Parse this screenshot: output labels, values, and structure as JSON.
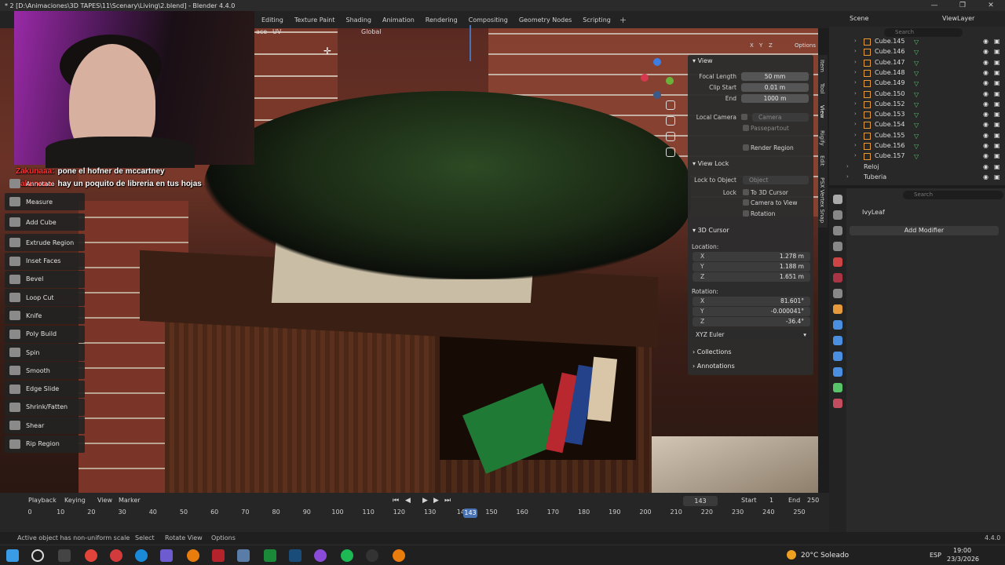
{
  "window": {
    "title": "* 2 [D:\\Animaciones\\3D TAPES\\11\\Scenary\\Living\\2.blend] - Blender 4.4.0",
    "controls": [
      "—",
      "❐",
      "✕"
    ]
  },
  "workspaces": [
    "Editing",
    "Texture Paint",
    "Shading",
    "Animation",
    "Rendering",
    "Compositing",
    "Geometry Nodes",
    "Scripting"
  ],
  "workspace_add": "+",
  "scene": {
    "label": "Scene",
    "view_layer": "ViewLayer"
  },
  "viewport_header": {
    "mode_items": [
      "ace",
      "UV"
    ],
    "orientation": "Global",
    "axes": [
      "X",
      "Y",
      "Z"
    ],
    "options": "Options"
  },
  "chat": [
    {
      "user": "Zakunaaa:",
      "message": "pone el hofner de mccartney"
    },
    {
      "user": "Zakunaaa:",
      "message": "hay un poquito de libreria en tus hojas"
    }
  ],
  "toolbar": {
    "tools": [
      "Annotate",
      "Measure",
      "Add Cube",
      "Extrude Region",
      "Inset Faces",
      "Bevel",
      "Loop Cut",
      "Knife",
      "Poly Build",
      "Spin",
      "Smooth",
      "Edge Slide",
      "Shrink/Fatten",
      "Shear",
      "Rip Region"
    ]
  },
  "npanel": {
    "view": {
      "title": "View",
      "focal_length_label": "Focal Length",
      "focal_length": "50 mm",
      "clip_start_label": "Clip Start",
      "clip_start": "0.01 m",
      "end_label": "End",
      "end": "1000 m",
      "local_camera_label": "Local Camera",
      "local_camera_placeholder": "Camera",
      "passepartout": "Passepartout",
      "render_region": "Render Region"
    },
    "view_lock": {
      "title": "View Lock",
      "lock_to_object_label": "Lock to Object",
      "lock_to_object_placeholder": "Object",
      "lock_label": "Lock",
      "to_3d_cursor": "To 3D Cursor",
      "camera_to_view": "Camera to View",
      "rotation": "Rotation"
    },
    "cursor": {
      "title": "3D Cursor",
      "location_label": "Location:",
      "location": [
        {
          "axis": "X",
          "value": "1.278 m"
        },
        {
          "axis": "Y",
          "value": "1.188 m"
        },
        {
          "axis": "Z",
          "value": "1.651 m"
        }
      ],
      "rotation_label": "Rotation:",
      "rotation": [
        {
          "axis": "X",
          "value": "81.601°"
        },
        {
          "axis": "Y",
          "value": "-0.000041°"
        },
        {
          "axis": "Z",
          "value": "-36.4°"
        }
      ],
      "rotation_mode": "XYZ Euler"
    },
    "collections": "Collections",
    "annotations": "Annotations"
  },
  "side_tabs": [
    "Item",
    "Tool",
    "View",
    "Rigify",
    "Edit",
    "PSX Vertex Snap"
  ],
  "outliner": {
    "search_placeholder": "Search",
    "rows": [
      "Cube.145",
      "Cube.146",
      "Cube.147",
      "Cube.148",
      "Cube.149",
      "Cube.150",
      "Cube.152",
      "Cube.153",
      "Cube.154",
      "Cube.155",
      "Cube.156",
      "Cube.157"
    ],
    "collections": [
      "Reloj",
      "Tuberia"
    ]
  },
  "properties": {
    "search_placeholder": "Search",
    "object_name": "IvyLeaf",
    "add_modifier": "Add Modifier"
  },
  "timeline": {
    "menus": [
      "Playback",
      "Keying",
      "View",
      "Marker"
    ],
    "current_frame": "143",
    "start_label": "Start",
    "start": "1",
    "end_label": "End",
    "end": "250",
    "ticks": [
      "0",
      "10",
      "20",
      "30",
      "40",
      "50",
      "60",
      "70",
      "80",
      "90",
      "100",
      "110",
      "120",
      "130",
      "14",
      "150",
      "160",
      "170",
      "180",
      "190",
      "200",
      "210",
      "220",
      "230",
      "240",
      "250"
    ]
  },
  "statusbar": {
    "message": "Active object has non-uniform scale",
    "hints": [
      "Select",
      "Rotate View",
      "Options"
    ],
    "version": "4.4.0"
  },
  "taskbar": {
    "weather": "20°C  Soleado",
    "language": "ESP",
    "time": "19:00",
    "date": "23/3/2026"
  }
}
